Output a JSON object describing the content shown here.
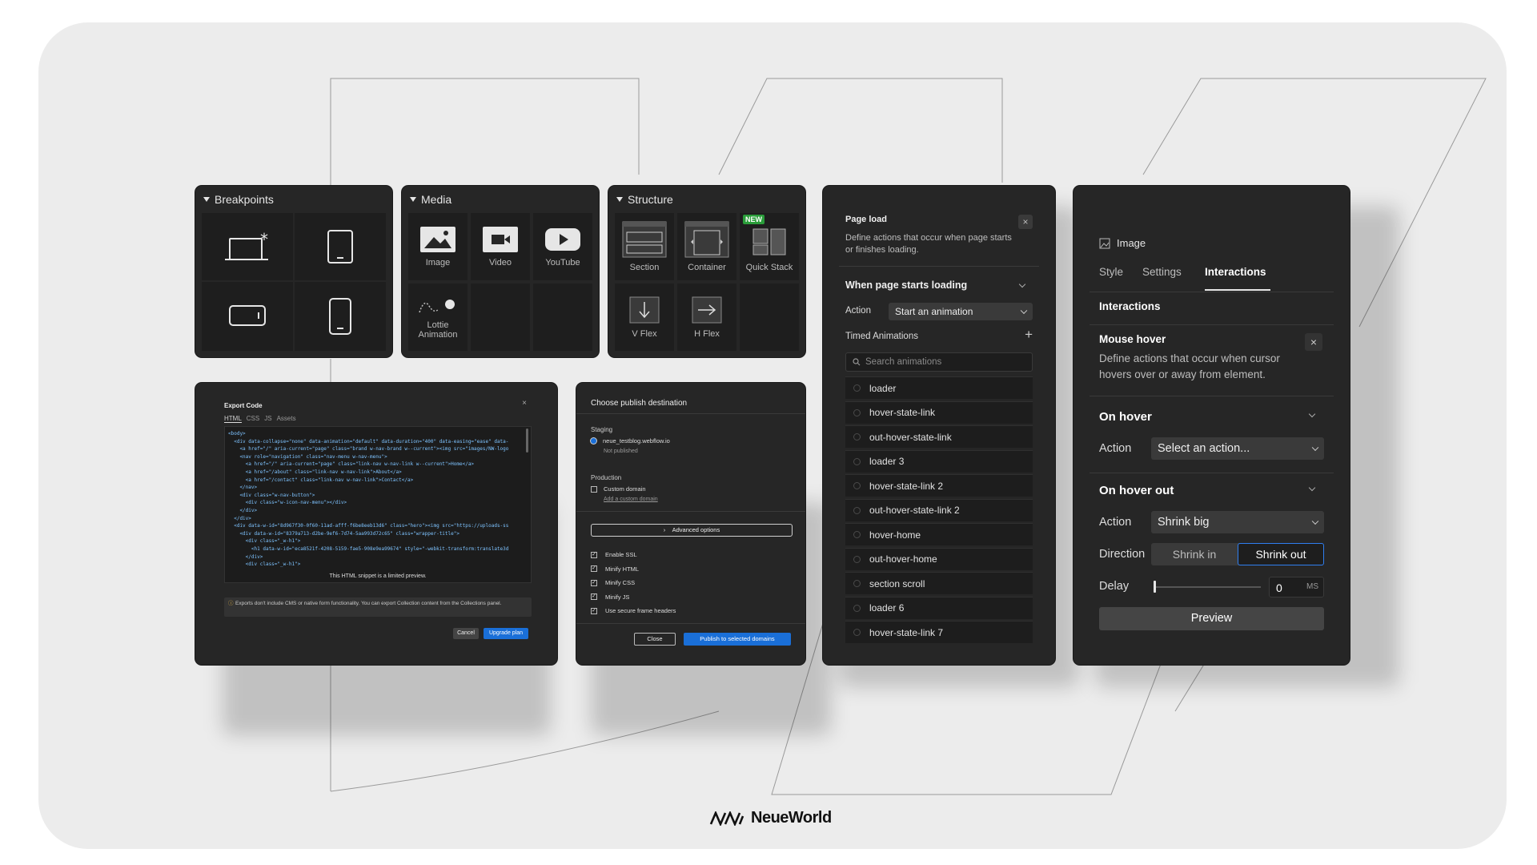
{
  "brand": {
    "name": "NeueWorld"
  },
  "breakpoints": {
    "title": "Breakpoints",
    "icons": [
      "desktop-base-icon",
      "tablet-icon",
      "mobile-landscape-icon",
      "mobile-portrait-icon"
    ]
  },
  "media": {
    "title": "Media",
    "items": [
      "Image",
      "Video",
      "YouTube",
      "Lottie Animation"
    ]
  },
  "structure": {
    "title": "Structure",
    "items": [
      "Section",
      "Container",
      "Quick Stack",
      "V Flex",
      "H Flex"
    ],
    "badge": "NEW"
  },
  "export": {
    "title": "Export Code",
    "tabs": [
      "HTML",
      "CSS",
      "JS",
      "Assets"
    ],
    "code_lines": [
      "<body>",
      "  <div data-collapse=\"none\" data-animation=\"default\" data-duration=\"400\" data-easing=\"ease\" data-",
      "    <a href=\"/\" aria-current=\"page\" class=\"brand w-nav-brand w--current\"><img src=\"images/NW-logo",
      "    <nav role=\"navigation\" class=\"nav-menu w-nav-menu\">",
      "      <a href=\"/\" aria-current=\"page\" class=\"link-nav w-nav-link w--current\">Home</a>",
      "      <a href=\"/about\" class=\"link-nav w-nav-link\">About</a>",
      "      <a href=\"/contact\" class=\"link-nav w-nav-link\">Contact</a>",
      "    </nav>",
      "    <div class=\"w-nav-button\">",
      "      <div class=\"w-icon-nav-menu\"></div>",
      "    </div>",
      "  </div>",
      "  <div data-w-id=\"8d967f30-0f60-11ad-afff-f6be8eeb13d6\" class=\"hero\"><img src=\"https://uploads-ss",
      "    <div data-w-id=\"8379a713-d2be-9ef6-7d74-5aa993d72c65\" class=\"wrapper-title\">",
      "      <div class=\"_w-h1\">",
      "        <h1 data-w-id=\"eca8521f-4208-5159-fae5-908e9ea99674\" style=\"-webkit-transform:translate3d",
      "      </div>",
      "      <div class=\"_w-h1\">"
    ],
    "snippet_note": "This HTML snippet is a limited preview.",
    "warning": "Exports don't include CMS or native form functionality. You can export Collection content from the Collections panel.",
    "cancel": "Cancel",
    "upgrade": "Upgrade plan"
  },
  "publish": {
    "title": "Choose publish destination",
    "staging_label": "Staging",
    "staging_domain": "neue_testblog.webflow.io",
    "staging_status": "Not published",
    "production_label": "Production",
    "custom_domain": "Custom domain",
    "add_domain": "Add a custom domain",
    "advanced": "Advanced options",
    "options": [
      "Enable SSL",
      "Minify HTML",
      "Minify CSS",
      "Minify JS",
      "Use secure frame headers"
    ],
    "close": "Close",
    "publish": "Publish to selected domains"
  },
  "pageload": {
    "title": "Page load",
    "desc": "Define actions that occur when page starts or finishes loading.",
    "section": "When page starts loading",
    "action_label": "Action",
    "action_value": "Start an animation",
    "timed": "Timed Animations",
    "search_placeholder": "Search animations",
    "animations": [
      "loader",
      "hover-state-link",
      "out-hover-state-link",
      "loader 3",
      "hover-state-link 2",
      "out-hover-state-link 2",
      "hover-home",
      "out-hover-home",
      "section scroll",
      "loader 6",
      "hover-state-link 7"
    ]
  },
  "inspector": {
    "element": "Image",
    "tabs": [
      "Style",
      "Settings",
      "Interactions"
    ],
    "section_title": "Interactions",
    "trigger_title": "Mouse hover",
    "trigger_desc": "Define actions that occur when cursor hovers over or away from element.",
    "on_hover": "On hover",
    "action_label": "Action",
    "hover_action": "Select an action...",
    "on_hover_out": "On hover out",
    "hover_out_action": "Shrink big",
    "direction_label": "Direction",
    "direction_options": [
      "Shrink in",
      "Shrink out"
    ],
    "delay_label": "Delay",
    "delay_value": "0",
    "delay_unit": "MS",
    "preview": "Preview"
  }
}
